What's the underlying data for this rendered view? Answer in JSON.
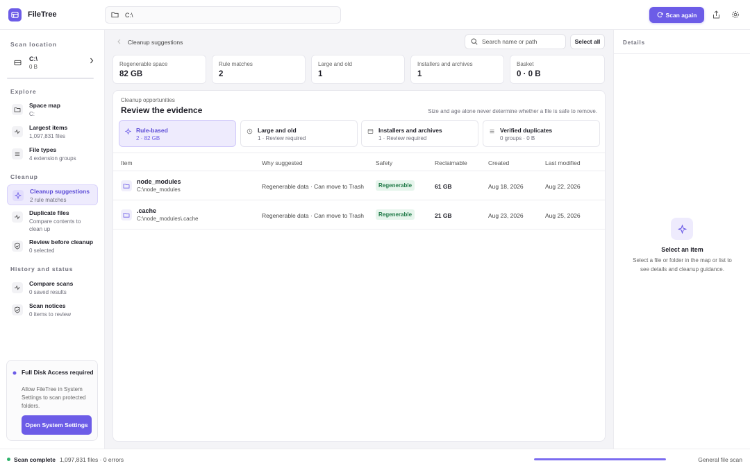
{
  "app": {
    "title": "FileTree"
  },
  "path": {
    "value": "C:\\"
  },
  "toolbar": {
    "scan_again_label": "Scan again"
  },
  "sidebar": {
    "scan_location_label": "Scan location",
    "location": {
      "name": "C:\\",
      "size": "0 B"
    },
    "explore_label": "Explore",
    "explore": [
      {
        "title": "Space map",
        "sub": "C:"
      },
      {
        "title": "Largest items",
        "sub": "1,097,831 files"
      },
      {
        "title": "File types",
        "sub": "4 extension groups"
      }
    ],
    "cleanup_label": "Cleanup",
    "cleanup": [
      {
        "title": "Cleanup suggestions",
        "sub": "2 rule matches"
      },
      {
        "title": "Duplicate files",
        "sub": "Compare contents to clean up"
      },
      {
        "title": "Review before cleanup",
        "sub": "0 selected"
      }
    ],
    "history_label": "History and status",
    "history": [
      {
        "title": "Compare scans",
        "sub": "0 saved results"
      },
      {
        "title": "Scan notices",
        "sub": "0 items to review"
      }
    ],
    "fda": {
      "title": "Full Disk Access required",
      "text": "Allow FileTree in System Settings to scan protected folders.",
      "button": "Open System Settings"
    }
  },
  "main": {
    "breadcrumb": "Cleanup suggestions",
    "search_placeholder": "Search name or path",
    "select_all_label": "Select all",
    "stats": [
      {
        "label": "Regenerable space",
        "value": "82 GB"
      },
      {
        "label": "Rule matches",
        "value": "2"
      },
      {
        "label": "Large and old",
        "value": "1"
      },
      {
        "label": "Installers and archives",
        "value": "1"
      },
      {
        "label": "Basket",
        "value": "0 · 0 B"
      }
    ],
    "panel": {
      "kicker": "Cleanup opportunities",
      "title": "Review the evidence",
      "note": "Size and age alone never determine whether a file is safe to remove."
    },
    "tabs": [
      {
        "title": "Rule-based",
        "sub": "2 · 82 GB"
      },
      {
        "title": "Large and old",
        "sub": "1 · Review required"
      },
      {
        "title": "Installers and archives",
        "sub": "1 · Review required"
      },
      {
        "title": "Verified duplicates",
        "sub": "0 groups · 0 B"
      }
    ],
    "columns": {
      "item": "Item",
      "why": "Why suggested",
      "safety": "Safety",
      "reclaimable": "Reclaimable",
      "created": "Created",
      "modified": "Last modified"
    },
    "rows": [
      {
        "name": "node_modules",
        "path": "C:\\node_modules",
        "why": "Regenerable data · Can move to Trash",
        "safety": "Regenerable",
        "reclaimable": "61 GB",
        "created": "Aug 18, 2026",
        "modified": "Aug 22, 2026"
      },
      {
        "name": ".cache",
        "path": "C:\\node_modules\\.cache",
        "why": "Regenerable data · Can move to Trash",
        "safety": "Regenerable",
        "reclaimable": "21 GB",
        "created": "Aug 23, 2026",
        "modified": "Aug 25, 2026"
      }
    ]
  },
  "details": {
    "label": "Details",
    "title": "Select an item",
    "text": "Select a file or folder in the map or list to see details and cleanup guidance."
  },
  "status": {
    "main": "Scan complete",
    "sub": "1,097,831 files · 0 errors",
    "progress_fraction": 1.0,
    "right": "General file scan"
  },
  "colors": {
    "accent": "#6c5ce7",
    "accent_soft": "#eeebfd",
    "success": "#2db36a",
    "badge_bg": "#e6f5ec",
    "badge_text": "#1f7a47"
  },
  "icons": {
    "app": "filetree-logo-icon",
    "path": "folder-icon",
    "scan": "refresh-icon",
    "export": "share-icon",
    "settings": "gear-icon",
    "drive": "drive-icon",
    "space_map": "folder-icon",
    "largest": "activity-icon",
    "file_types": "list-icon",
    "suggestions": "sparkle-icon",
    "duplicates": "activity-icon",
    "review": "shield-icon",
    "compare": "activity-icon",
    "notices": "shield-icon"
  }
}
